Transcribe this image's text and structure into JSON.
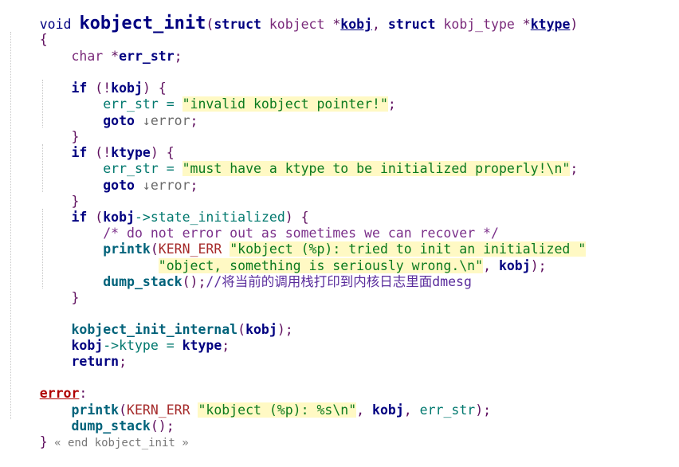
{
  "code": {
    "l1": {
      "kw1": "void",
      "fn": "kobject_init",
      "p1": "(",
      "kw2": "struct",
      "ty1": " kobject ",
      "star1": "*",
      "a1": "kobj",
      "comma": ", ",
      "kw3": "struct",
      "ty2": " kobj_type ",
      "star2": "*",
      "a2": "ktype",
      "p2": ")"
    },
    "l2": {
      "brace": "{"
    },
    "l3": {
      "ty": "char",
      "star": " *",
      "var": "err_str",
      "semi": ";"
    },
    "l5": {
      "kw": "if",
      "open": " (!",
      "var": "kobj",
      "close": ") {"
    },
    "l6": {
      "var": "err_str",
      "eq": " = ",
      "str": "\"invalid kobject pointer!\"",
      "semi": ";"
    },
    "l7": {
      "kw": "goto",
      "arrow": " ↓",
      "label": "error",
      "semi": ";"
    },
    "l8": {
      "brace": "}"
    },
    "l9": {
      "kw": "if",
      "open": " (!",
      "var": "ktype",
      "close": ") {"
    },
    "l10": {
      "var": "err_str",
      "eq": " = ",
      "str": "\"must have a ktype to be initialized properly!\\n\"",
      "semi": ";"
    },
    "l11": {
      "kw": "goto",
      "arrow": " ↓",
      "label": "error",
      "semi": ";"
    },
    "l12": {
      "brace": "}"
    },
    "l13": {
      "kw": "if",
      "open": " (",
      "var": "kobj",
      "arrow": "->",
      "field": "state_initialized",
      "close": ") {"
    },
    "l14": {
      "comment": "/* do not error out as sometimes we can recover */"
    },
    "l15": {
      "fn": "printk",
      "open": "(",
      "macro": "KERN_ERR",
      "sp": " ",
      "str": "\"kobject (%p): tried to init an initialized \""
    },
    "l16": {
      "str": "\"object, something is seriously wrong.\\n\"",
      "comma": ", ",
      "var": "kobj",
      "close": ");"
    },
    "l17": {
      "fn": "dump_stack",
      "close": "();",
      "comment": "//将当前的调用栈打印到内核日志里面dmesg"
    },
    "l18": {
      "brace": "}"
    },
    "l20": {
      "fn": "kobject_init_internal",
      "open": "(",
      "var": "kobj",
      "close": ");"
    },
    "l21": {
      "var": "kobj",
      "arrow": "->",
      "field": "ktype",
      "eq": " = ",
      "var2": "ktype",
      "semi": ";"
    },
    "l22": {
      "kw": "return",
      "semi": ";"
    },
    "l24": {
      "label": "error",
      "colon": ":"
    },
    "l25": {
      "fn": "printk",
      "open": "(",
      "macro": "KERN_ERR",
      "sp": " ",
      "str": "\"kobject (%p): %s\\n\"",
      "comma1": ", ",
      "var1": "kobj",
      "comma2": ", ",
      "var2": "err_str",
      "close": ");"
    },
    "l26": {
      "fn": "dump_stack",
      "close": "();"
    },
    "l27": {
      "brace": "}",
      "fold": " « end kobject_init »"
    }
  }
}
